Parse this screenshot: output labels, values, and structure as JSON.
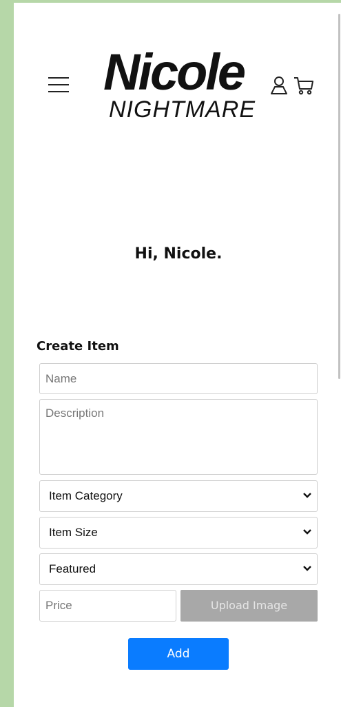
{
  "header": {
    "logo_main": "Nicole",
    "logo_sub": "NIGHTMARE",
    "icons": [
      "menu-icon",
      "user-icon",
      "cart-icon"
    ]
  },
  "greeting": "Hi, Nicole.",
  "form": {
    "title": "Create Item",
    "name_placeholder": "Name",
    "description_placeholder": "Description",
    "category_selected": "Item Category",
    "size_selected": "Item Size",
    "featured_selected": "Featured",
    "price_placeholder": "Price",
    "upload_label": "Upload Image",
    "add_label": "Add"
  },
  "colors": {
    "frame": "#b6d7a8",
    "add_button": "#0a7cff",
    "upload_button": "#a8a8a8"
  }
}
